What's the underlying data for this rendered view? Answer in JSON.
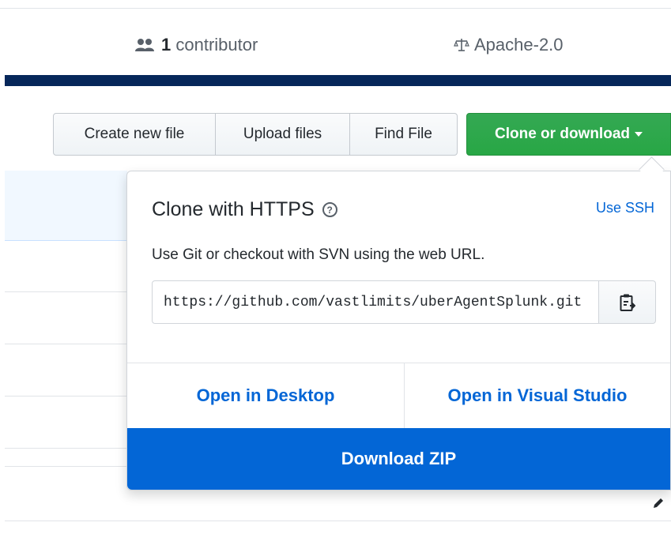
{
  "summary": {
    "contributor_count": "1",
    "contributor_label": "contributor",
    "contributor_icon": "people-icon",
    "license": "Apache-2.0",
    "license_icon": "law-scale-icon"
  },
  "file_nav": {
    "create_new_file": "Create new file",
    "upload_files": "Upload files",
    "find_file": "Find File",
    "clone_or_download": "Clone or download"
  },
  "clone_dropdown": {
    "title": "Clone with HTTPS",
    "help_icon": "question-circle-icon",
    "use_ssh": "Use SSH",
    "description": "Use Git or checkout with SVN using the web URL.",
    "url": "https://github.com/vastlimits/uberAgentSplunk.git",
    "copy_icon": "clipboard-icon",
    "open_in_desktop": "Open in Desktop",
    "open_in_visual_studio": "Open in Visual Studio",
    "download_zip": "Download ZIP"
  },
  "colors": {
    "navy_bar": "#06275a",
    "clone_green": "#28a745",
    "link_blue": "#0366d6",
    "zip_blue": "#0366d6"
  }
}
